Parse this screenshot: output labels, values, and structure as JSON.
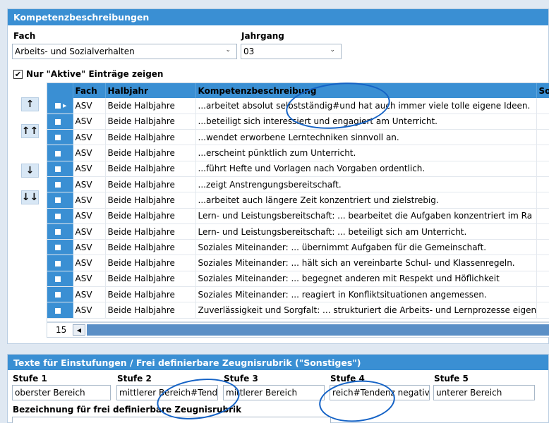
{
  "competence_panel": {
    "title": "Kompetenzbeschreibungen",
    "fach_label": "Fach",
    "fach_value": "Arbeits- und Sozialverhalten",
    "jahrgang_label": "Jahrgang",
    "jahrgang_value": "03",
    "active_only_label": "Nur \"Aktive\" Einträge zeigen",
    "active_only_checked": true,
    "move_buttons": [
      "↑",
      "↑↑",
      "↓",
      "↓↓"
    ],
    "columns": [
      "",
      "Fach",
      "Halbjahr",
      "Kompetenzbeschreibung",
      "Sor"
    ],
    "rows": [
      {
        "fach": "ASV",
        "halbjahr": "Beide Halbjahre",
        "beschreibung": "...arbeitet absolut selbstständig#und hat auch immer viele tolle eigene Ideen."
      },
      {
        "fach": "ASV",
        "halbjahr": "Beide Halbjahre",
        "beschreibung": "...beteiligt sich interessiert und engagiert am Unterricht."
      },
      {
        "fach": "ASV",
        "halbjahr": "Beide Halbjahre",
        "beschreibung": "...wendet erworbene Lerntechniken sinnvoll an."
      },
      {
        "fach": "ASV",
        "halbjahr": "Beide Halbjahre",
        "beschreibung": "...erscheint pünktlich zum Unterricht."
      },
      {
        "fach": "ASV",
        "halbjahr": "Beide Halbjahre",
        "beschreibung": "...führt Hefte und Vorlagen nach Vorgaben ordentlich."
      },
      {
        "fach": "ASV",
        "halbjahr": "Beide Halbjahre",
        "beschreibung": "...zeigt Anstrengungsbereitschaft."
      },
      {
        "fach": "ASV",
        "halbjahr": "Beide Halbjahre",
        "beschreibung": "...arbeitet auch längere Zeit konzentriert und zielstrebig."
      },
      {
        "fach": "ASV",
        "halbjahr": "Beide Halbjahre",
        "beschreibung": "Lern- und Leistungsbereitschaft: ... bearbeitet die Aufgaben konzentriert im Ra"
      },
      {
        "fach": "ASV",
        "halbjahr": "Beide Halbjahre",
        "beschreibung": "Lern- und Leistungsbereitschaft: ... beteiligt sich am Unterricht."
      },
      {
        "fach": "ASV",
        "halbjahr": "Beide Halbjahre",
        "beschreibung": "Soziales Miteinander: ... übernimmt Aufgaben für die Gemeinschaft."
      },
      {
        "fach": "ASV",
        "halbjahr": "Beide Halbjahre",
        "beschreibung": "Soziales Miteinander: ... hält sich an vereinbarte Schul- und Klassenregeln."
      },
      {
        "fach": "ASV",
        "halbjahr": "Beide Halbjahre",
        "beschreibung": "Soziales Miteinander: ... begegnet anderen mit Respekt und Höflichkeit"
      },
      {
        "fach": "ASV",
        "halbjahr": "Beide Halbjahre",
        "beschreibung": "Soziales Miteinander: ... reagiert in Konfliktsituationen angemessen."
      },
      {
        "fach": "ASV",
        "halbjahr": "Beide Halbjahre",
        "beschreibung": "Zuverlässigkeit und Sorgfalt: ... strukturiert die Arbeits- und Lernprozesse eigen"
      }
    ],
    "record_count": "15"
  },
  "rating_panel": {
    "title": "Texte für Einstufungen / Frei definierbare Zeugnisrubrik (\"Sonstiges\")",
    "stufen": [
      {
        "label": "Stufe 1",
        "value": "oberster Bereich"
      },
      {
        "label": "Stufe 2",
        "value": "mittlerer Bereich#Tendenz"
      },
      {
        "label": "Stufe 3",
        "value": "mittlerer Bereich"
      },
      {
        "label": "Stufe 4",
        "value": "reich#Tendenz negativ"
      },
      {
        "label": "Stufe 5",
        "value": "unterer Bereich"
      }
    ],
    "free_rubric_label": "Bezeichnung für frei definierbare Zeugnisrubrik"
  },
  "colors": {
    "accent": "#3a8fd3",
    "annotation": "#1563c6"
  }
}
